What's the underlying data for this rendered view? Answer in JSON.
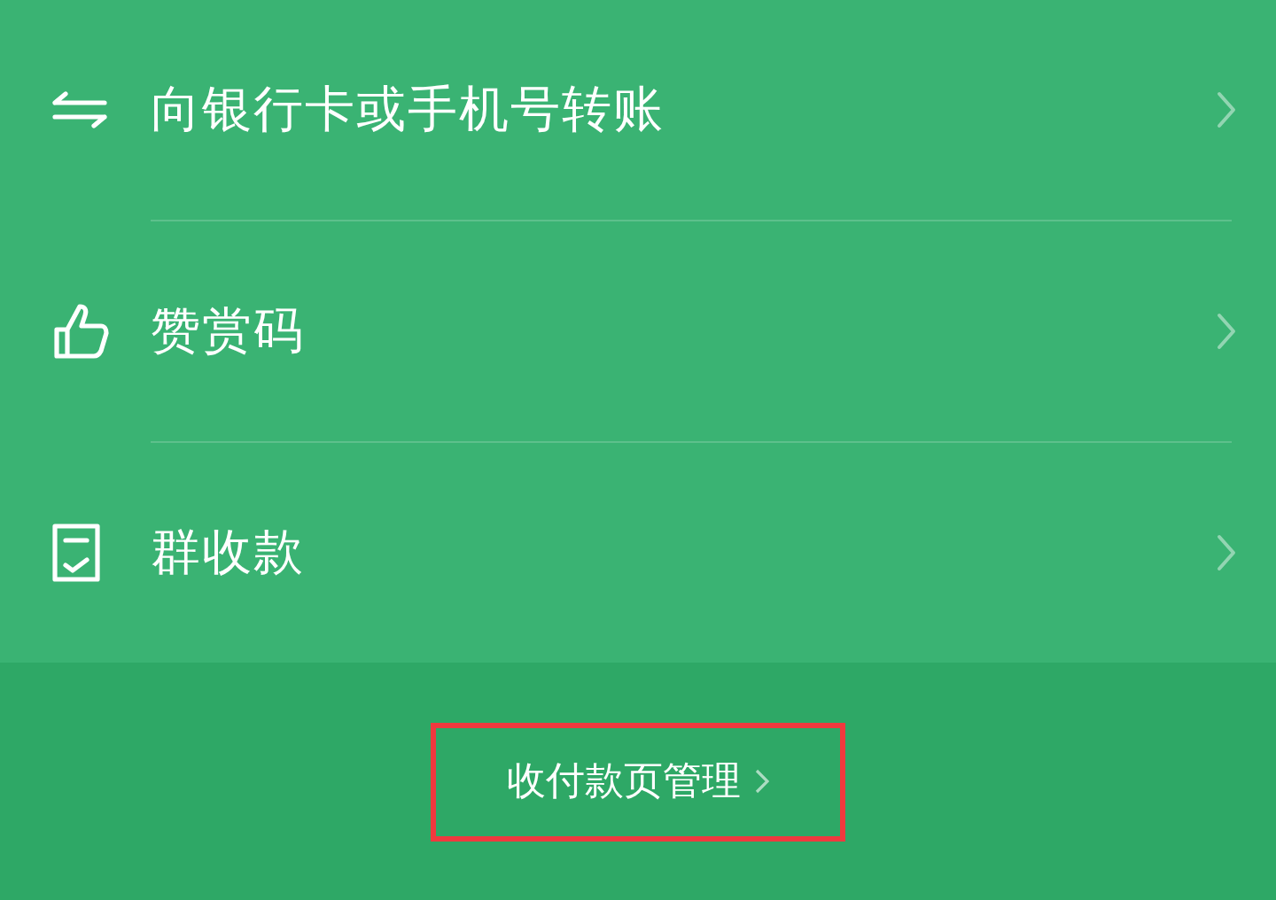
{
  "menu": {
    "items": [
      {
        "kind": "transfer",
        "label": "向银行卡或手机号转账"
      },
      {
        "kind": "reward",
        "label": "赞赏码"
      },
      {
        "kind": "group",
        "label": "群收款"
      }
    ]
  },
  "footer": {
    "link": "收付款页管理",
    "highlighted": true
  }
}
